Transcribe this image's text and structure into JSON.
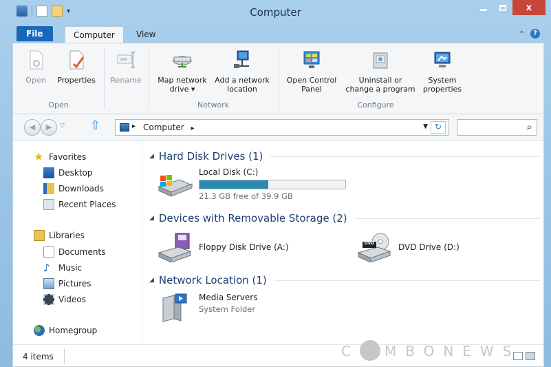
{
  "window": {
    "title": "Computer",
    "controls": {
      "minimize": "",
      "maximize": "",
      "close": "x"
    }
  },
  "tabs": {
    "file": "File",
    "computer": "Computer",
    "view": "View",
    "expand": "⌃",
    "help": "?"
  },
  "ribbon": {
    "groups": [
      {
        "label": "Open",
        "buttons": [
          {
            "line1": "Open",
            "line2": ""
          },
          {
            "line1": "Properties",
            "line2": ""
          }
        ]
      },
      {
        "label": "",
        "buttons": [
          {
            "line1": "Rename",
            "line2": ""
          }
        ]
      },
      {
        "label": "Network",
        "buttons": [
          {
            "line1": "Map network",
            "line2": "drive ▾"
          },
          {
            "line1": "Add a network",
            "line2": "location"
          }
        ]
      },
      {
        "label": "Configure",
        "buttons": [
          {
            "line1": "Open Control",
            "line2": "Panel"
          },
          {
            "line1": "Uninstall or",
            "line2": "change a program"
          },
          {
            "line1": "System",
            "line2": "properties"
          }
        ]
      }
    ]
  },
  "address": {
    "path": "Computer",
    "sep": "▸",
    "refresh": "↻",
    "search_icon": "⌕"
  },
  "nav": {
    "favorites": "Favorites",
    "desktop": "Desktop",
    "downloads": "Downloads",
    "recent": "Recent Places",
    "libraries": "Libraries",
    "documents": "Documents",
    "music": "Music",
    "pictures": "Pictures",
    "videos": "Videos",
    "homegroup": "Homegroup"
  },
  "sections": {
    "hdd": "Hard Disk Drives (1)",
    "removable": "Devices with Removable Storage (2)",
    "network": "Network Location (1)"
  },
  "drives": {
    "c": {
      "name": "Local Disk (C:)",
      "free": "21.3 GB free of 39.9 GB",
      "used_fraction": 0.47
    },
    "floppy": {
      "name": "Floppy Disk Drive (A:)"
    },
    "dvd": {
      "name": "DVD Drive (D:)",
      "badge": "DVD"
    },
    "media": {
      "name": "Media Servers",
      "sub": "System Folder"
    }
  },
  "status": {
    "count": "4 items"
  },
  "watermark": {
    "text": "CMBONEWS"
  },
  "colors": {
    "accent": "#1a66b8",
    "bar_fill": "#2d8bb0",
    "section_title": "#1e3f73"
  }
}
